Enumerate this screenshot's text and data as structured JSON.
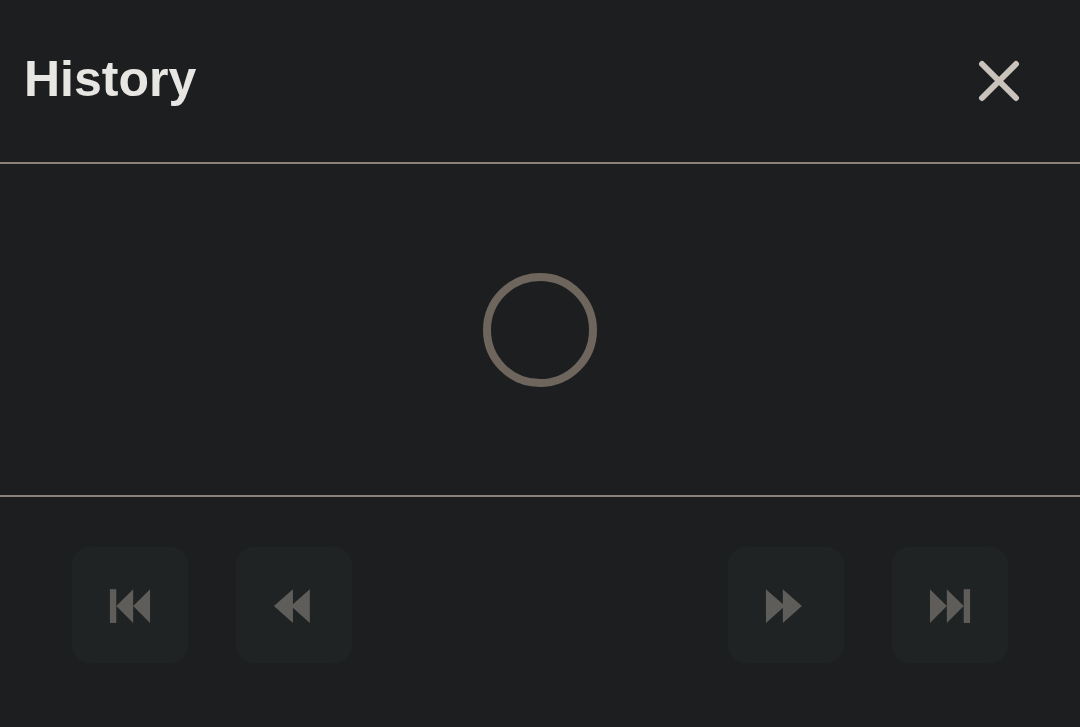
{
  "header": {
    "title": "History"
  },
  "loading": true,
  "controls": [
    {
      "kind": "first",
      "disabled": true
    },
    {
      "kind": "previous",
      "disabled": true
    },
    {
      "kind": "next",
      "disabled": true
    },
    {
      "kind": "last",
      "disabled": true
    }
  ]
}
